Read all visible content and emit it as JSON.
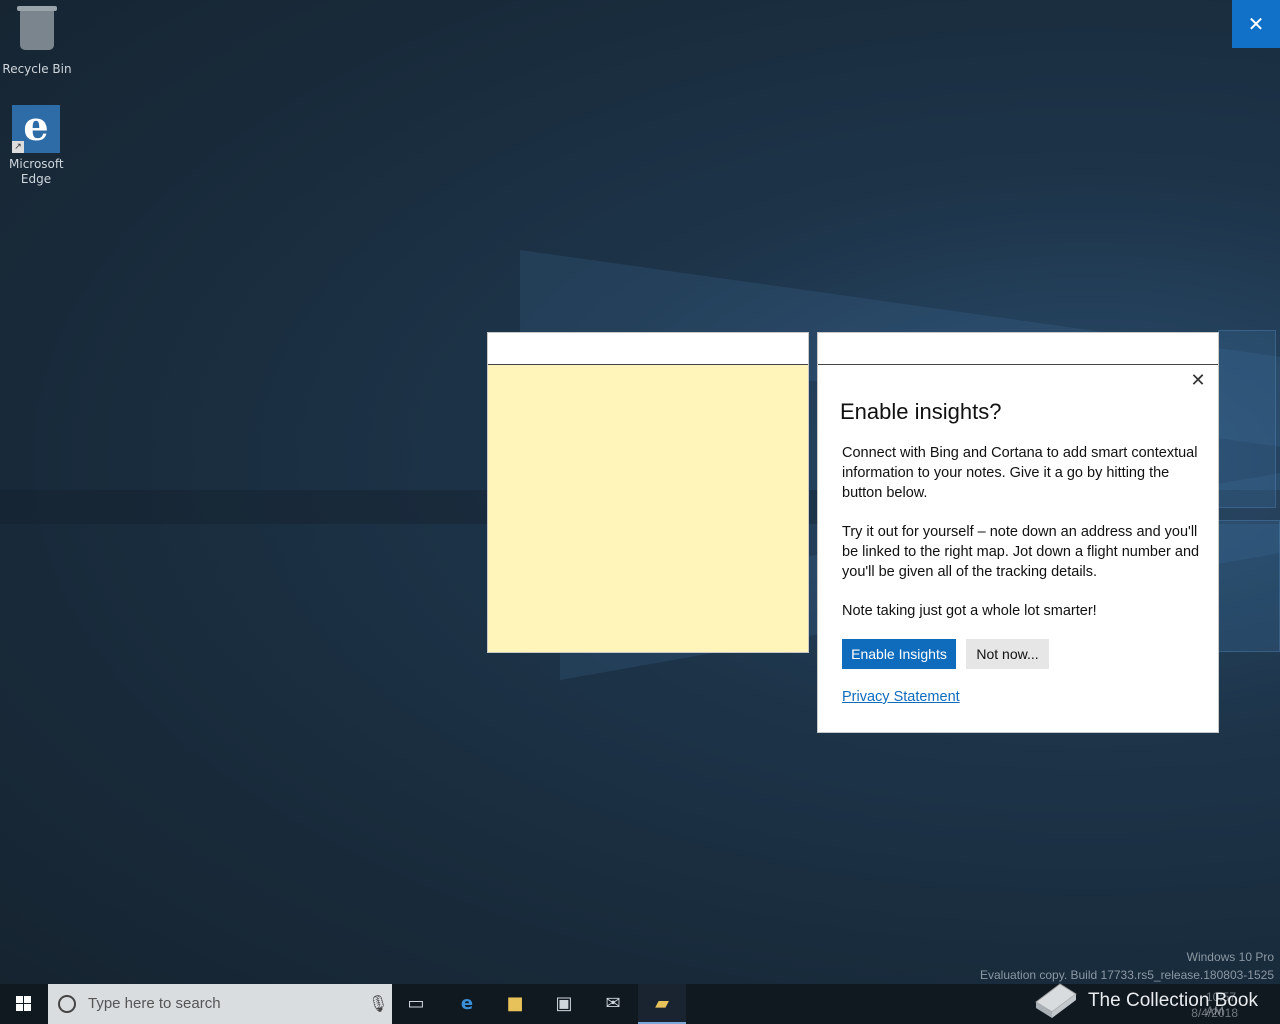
{
  "desktop": {
    "icons": [
      {
        "label": "Recycle Bin",
        "icon": "recycle-bin-icon"
      },
      {
        "label": "Microsoft Edge",
        "icon": "edge-icon"
      }
    ]
  },
  "top_close": {
    "glyph": "✕"
  },
  "insights": {
    "title": "Enable insights?",
    "paragraphs": [
      "Connect with Bing and Cortana to add smart contextual information to your notes. Give it a go by hitting the button below.",
      "Try it out for yourself – note down an address and you'll be linked to the right map. Jot down a flight number and you'll be given all of the tracking details.",
      "Note taking just got a whole lot smarter!"
    ],
    "enable_label": "Enable Insights",
    "not_now_label": "Not now...",
    "privacy_label": "Privacy Statement",
    "close_glyph": "✕"
  },
  "watermark": {
    "edition": "Windows 10 Pro",
    "build": "Evaluation copy. Build 17733.rs5_release.180803-1525"
  },
  "taskbar": {
    "search_placeholder": "Type here to search",
    "time": "10:57 AM",
    "date": "8/4/2018"
  },
  "brand": "The Collection Book",
  "colors": {
    "accent": "#0f6cbd",
    "note": "#fff4b9"
  }
}
